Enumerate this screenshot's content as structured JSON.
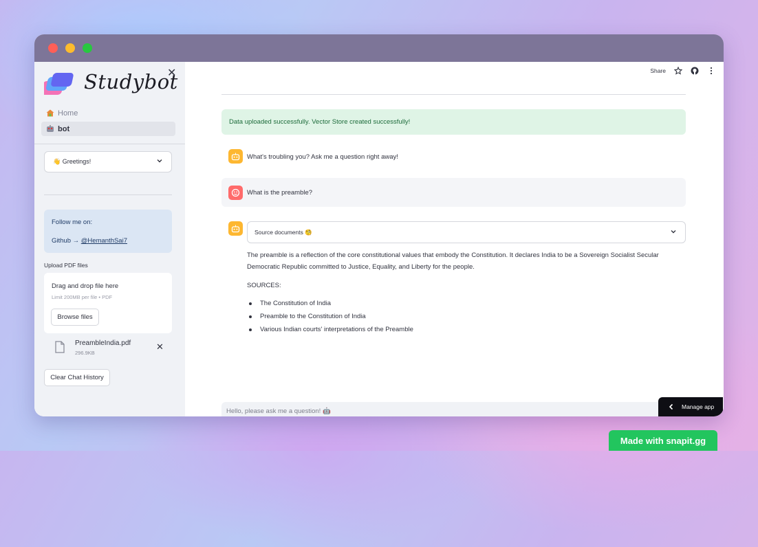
{
  "app": {
    "name": "Studybot"
  },
  "sidebar": {
    "nav": [
      {
        "label": "Home",
        "icon": "house-icon"
      },
      {
        "label": "bot",
        "icon": "robot-icon"
      }
    ],
    "select": {
      "value": "👋 Greetings!"
    },
    "info": {
      "line1": "Follow me on:",
      "github_prefix": "Github → ",
      "github_handle": "@HemanthSai7"
    },
    "upload": {
      "label": "Upload PDF files",
      "drop_text": "Drag and drop file here",
      "limit_text": "Limit 200MB per file • PDF",
      "browse_label": "Browse files",
      "file": {
        "name": "PreambleIndia.pdf",
        "size": "296.9KB"
      }
    },
    "clear_label": "Clear Chat History"
  },
  "toolbar": {
    "share_label": "Share"
  },
  "main": {
    "success": "Data uploaded successfully. Vector Store created successfully!",
    "messages": [
      {
        "role": "assistant",
        "text": "What's troubling you? Ask me a question right away!"
      },
      {
        "role": "user",
        "text": "What is the preamble?"
      }
    ],
    "answer": {
      "expander_label": "Source documents 🧐",
      "text": "The preamble is a reflection of the core constitutional values that embody the Constitution. It declares India to be a Sovereign Socialist Secular Democratic Republic committed to Justice, Equality, and Liberty for the people.",
      "sources_label": "SOURCES:",
      "sources": [
        "The Constitution of India",
        "Preamble to the Constitution of India",
        "Various Indian courts' interpretations of the Preamble"
      ]
    },
    "chat_input": {
      "placeholder": "Hello, please ask me a question! 🤖"
    }
  },
  "manage_app_label": "Manage app",
  "badge": "Made with snapit.gg",
  "colors": {
    "bot_avatar": "#fdb731",
    "user_avatar": "#ff6b6b",
    "success_bg": "#dff4e6",
    "info_bg": "#dbe6f4"
  }
}
